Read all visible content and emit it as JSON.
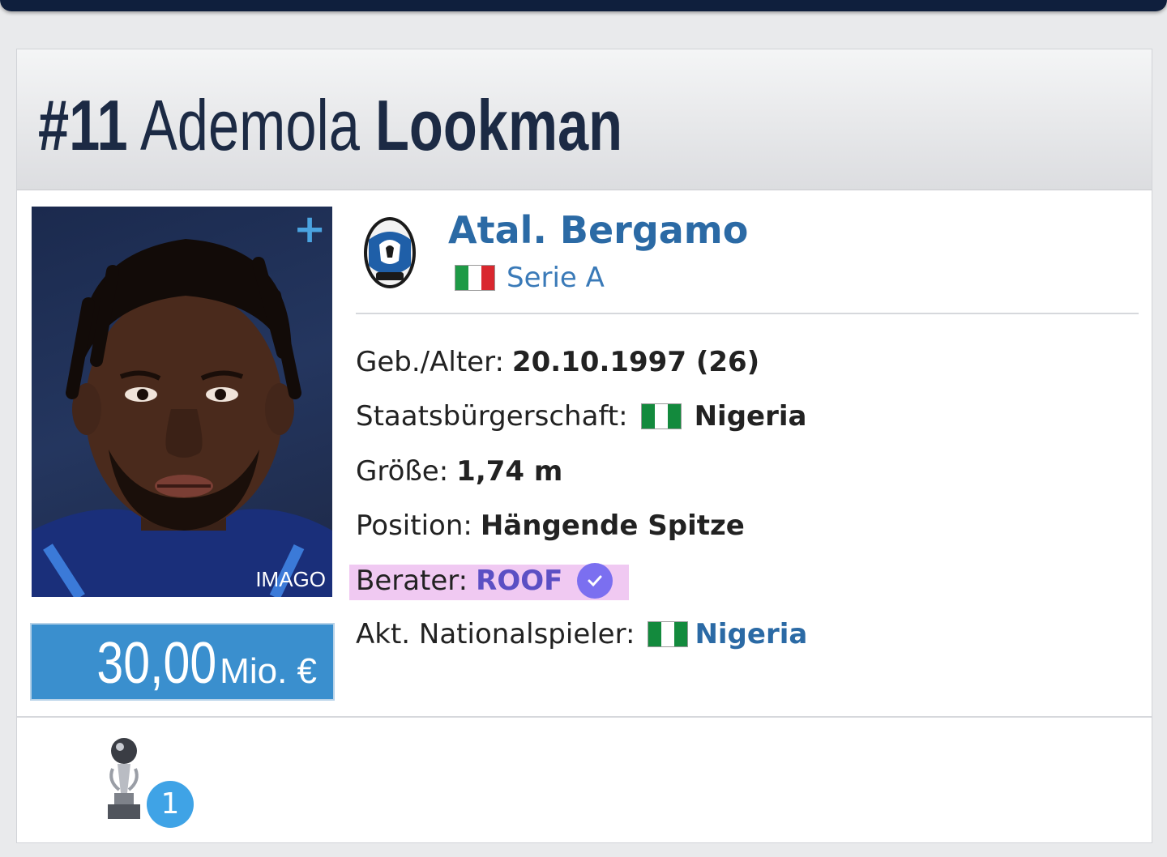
{
  "header": {
    "number": "#11",
    "first_name": "Ademola",
    "last_name": "Lookman"
  },
  "photo": {
    "expand_icon": "plus-icon",
    "credit": "IMAGO"
  },
  "market_value": {
    "amount": "30,00",
    "unit": "Mio. €"
  },
  "club": {
    "name": "Atal. Bergamo",
    "league": "Serie A",
    "league_country_flag": "Italy"
  },
  "info": {
    "birth_label": "Geb./Alter:",
    "birth_value": "20.10.1997 (26)",
    "citizenship_label": "Staatsbürgerschaft:",
    "citizenship_value": "Nigeria",
    "height_label": "Größe:",
    "height_value": "1,74 m",
    "position_label": "Position:",
    "position_value": "Hängende Spitze",
    "agent_label": "Berater:",
    "agent_value": "ROOF",
    "national_label": "Akt. Nationalspieler:",
    "national_value": "Nigeria"
  },
  "achievements": {
    "trophy_count": "1"
  },
  "colors": {
    "header_text": "#1c2a44",
    "link": "#2b6aa5",
    "value_box": "#3a8fce",
    "highlight": "#f0c9f2",
    "verified": "#7b6ff0",
    "badge": "#3fa3e6"
  }
}
